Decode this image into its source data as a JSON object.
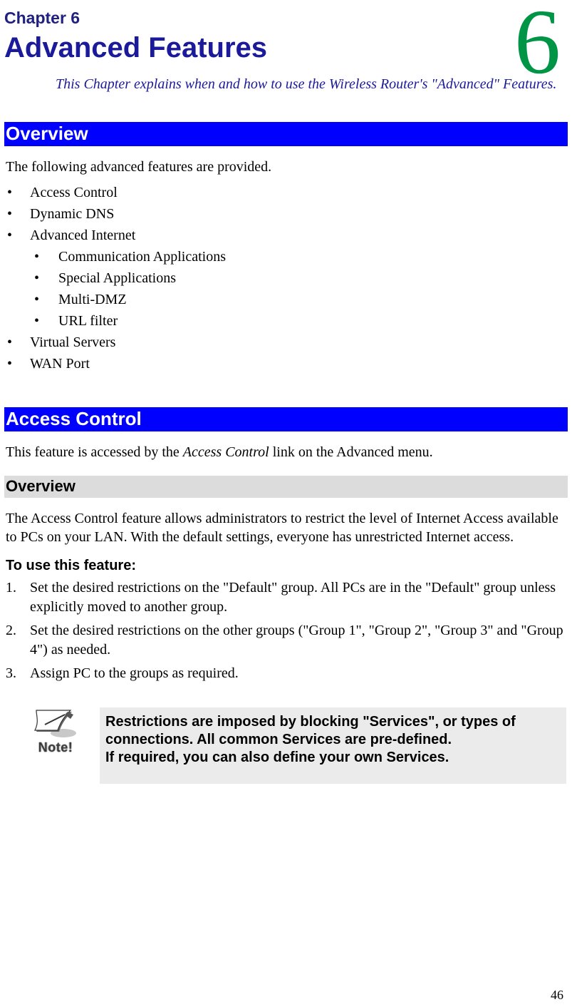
{
  "chapter": {
    "label": "Chapter 6",
    "title": "Advanced Features",
    "numeral": "6"
  },
  "intro": "This Chapter explains when and how to use the Wireless Router's \"Advanced\" Features.",
  "section_overview": {
    "heading": "Overview",
    "lead": "The following advanced features are provided.",
    "items": [
      "Access Control",
      "Dynamic DNS",
      "Advanced Internet",
      "Virtual Servers",
      "WAN Port"
    ],
    "advanced_internet_sub": [
      "Communication Applications",
      "Special Applications",
      "Multi-DMZ",
      "URL filter"
    ]
  },
  "section_access": {
    "heading": "Access Control",
    "lead_prefix": "This feature is accessed by the ",
    "lead_em": "Access Control",
    "lead_suffix": " link on the Advanced menu.",
    "sub_overview_heading": "Overview",
    "sub_overview_body": "The Access Control feature allows administrators to restrict the level of Internet Access available to PCs on your LAN. With the default settings, everyone has unrestricted Internet access.",
    "use_heading": "To use this feature:",
    "steps": [
      "Set the desired restrictions on the \"Default\" group. All PCs are in the \"Default\" group unless explicitly moved to another group.",
      "Set the desired restrictions on the other groups (\"Group 1\", \"Group 2\", \"Group 3\" and \"Group 4\") as needed.",
      "Assign PC to the groups as required."
    ],
    "note": {
      "icon_label": "Note!",
      "line1": "Restrictions are imposed by blocking \"Services\", or types of connections. All common Services are pre-defined.",
      "line2": "If required, you can also define your own Services."
    }
  },
  "page_number": "46"
}
